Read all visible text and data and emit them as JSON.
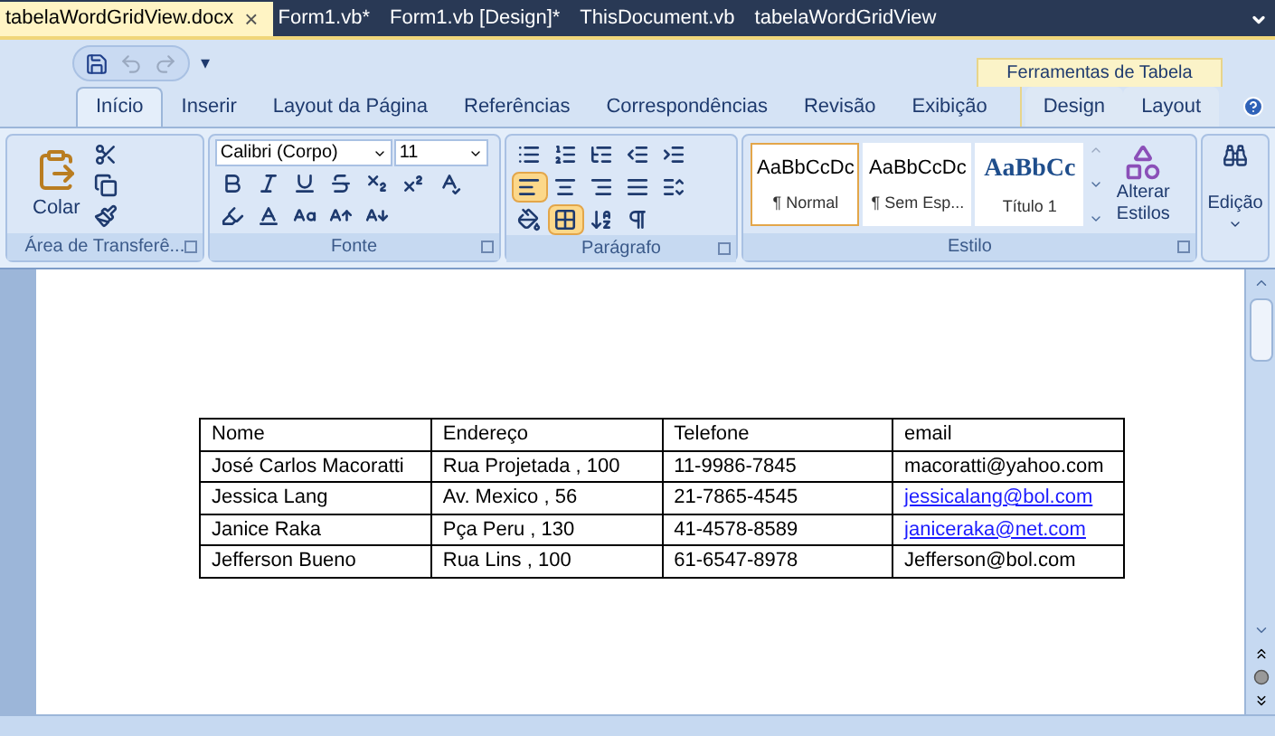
{
  "doc_tabs": [
    {
      "label": "tabelaWordGridView.docx",
      "selected": true,
      "close": "×"
    },
    {
      "label": "Form1.vb*",
      "selected": false
    },
    {
      "label": "Form1.vb [Design]*",
      "selected": false
    },
    {
      "label": "ThisDocument.vb",
      "selected": false
    },
    {
      "label": "tabelaWordGridView",
      "selected": false
    }
  ],
  "qat": {
    "more": "▾"
  },
  "context_header": "Ferramentas de Tabela",
  "ribbon_tabs": [
    {
      "label": "Início",
      "selected": true,
      "context": false
    },
    {
      "label": "Inserir",
      "selected": false,
      "context": false
    },
    {
      "label": "Layout da Página",
      "selected": false,
      "context": false
    },
    {
      "label": "Referências",
      "selected": false,
      "context": false
    },
    {
      "label": "Correspondências",
      "selected": false,
      "context": false
    },
    {
      "label": "Revisão",
      "selected": false,
      "context": false
    },
    {
      "label": "Exibição",
      "selected": false,
      "context": false
    },
    {
      "label": "Design",
      "selected": false,
      "context": true
    },
    {
      "label": "Layout",
      "selected": false,
      "context": true
    }
  ],
  "groups": {
    "clipboard": {
      "label": "Área de Transferê...",
      "paste": "Colar"
    },
    "font": {
      "label": "Fonte",
      "font_name": "Calibri (Corpo)",
      "font_size": "11"
    },
    "paragraph": {
      "label": "Parágrafo"
    },
    "styles": {
      "label": "Estilo",
      "items": [
        {
          "preview": "AaBbCcDc",
          "name": "¶ Normal",
          "selected": true,
          "kind": "normal"
        },
        {
          "preview": "AaBbCcDc",
          "name": "¶ Sem Esp...",
          "selected": false,
          "kind": "normal"
        },
        {
          "preview": "AaBbCc",
          "name": "Título 1",
          "selected": false,
          "kind": "heading"
        }
      ],
      "change": [
        "Alterar",
        "Estilos"
      ]
    },
    "editing": {
      "label": "Edição"
    }
  },
  "table": {
    "columns": [
      "Nome",
      "Endereço",
      "Telefone",
      "email"
    ],
    "rows": [
      [
        {
          "text": "José Carlos Macoratti",
          "kind": "text"
        },
        {
          "text": "Rua Projetada , 100",
          "kind": "text"
        },
        {
          "text": "11-9986-7845",
          "kind": "text"
        },
        {
          "text": "macoratti@yahoo.com",
          "kind": "text"
        }
      ],
      [
        {
          "text": "Jessica Lang",
          "kind": "text"
        },
        {
          "text": "Av. Mexico , 56",
          "kind": "text"
        },
        {
          "text": "21-7865-4545",
          "kind": "text"
        },
        {
          "text": "jessicalang@bol.com",
          "kind": "link"
        }
      ],
      [
        {
          "text": "Janice Raka",
          "kind": "text"
        },
        {
          "text": "Pça  Peru , 130",
          "kind": "text"
        },
        {
          "text": "41-4578-8589",
          "kind": "text"
        },
        {
          "text": "janiceraka@net.com",
          "kind": "link"
        }
      ],
      [
        {
          "text": "Jefferson Bueno",
          "kind": "text"
        },
        {
          "text": "Rua Lins , 100",
          "kind": "text"
        },
        {
          "text": "61-6547-8978",
          "kind": "text"
        },
        {
          "text": "Jefferson@bol.com",
          "kind": "text"
        }
      ]
    ]
  }
}
